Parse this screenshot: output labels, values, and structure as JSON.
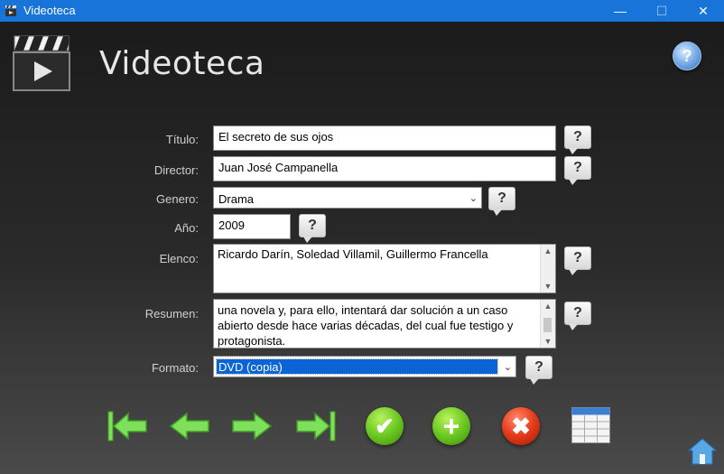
{
  "window": {
    "title": "Videoteca",
    "controls": {
      "minimize": "—",
      "maximize": "☐",
      "close": "✕"
    }
  },
  "header": {
    "app_title": "Videoteca",
    "help_glyph": "?"
  },
  "form": {
    "titulo": {
      "label": "Título:",
      "value": "El secreto de sus ojos"
    },
    "director": {
      "label": "Director:",
      "value": "Juan José Campanella"
    },
    "genero": {
      "label": "Genero:",
      "value": "Drama"
    },
    "anio": {
      "label": "Año:",
      "value": "2009"
    },
    "elenco": {
      "label": "Elenco:",
      "value": "Ricardo Darín, Soledad Villamil, Guillermo Francella"
    },
    "resumen": {
      "label": "Resumen:",
      "value": "una novela y, para ello, intentará dar solución a un caso abierto desde hace varias décadas, del cual fue testigo y protagonista."
    },
    "formato": {
      "label": "Formato:",
      "value": "DVD (copia)"
    },
    "help_glyph": "?"
  },
  "toolbar": {
    "accept_glyph": "✔",
    "add_glyph": "+",
    "delete_glyph": "✖"
  },
  "icons": [
    "app-clapper-icon",
    "help-icon",
    "first-record-icon",
    "previous-record-icon",
    "next-record-icon",
    "last-record-icon",
    "accept-icon",
    "add-icon",
    "delete-icon",
    "table-grid-icon",
    "home-icon"
  ],
  "colors": {
    "titlebar": "#1874d8",
    "selection": "#0a64d6",
    "nav_arrows": "#7ee05a",
    "accept": "#6bc821",
    "delete": "#e43a1a"
  }
}
